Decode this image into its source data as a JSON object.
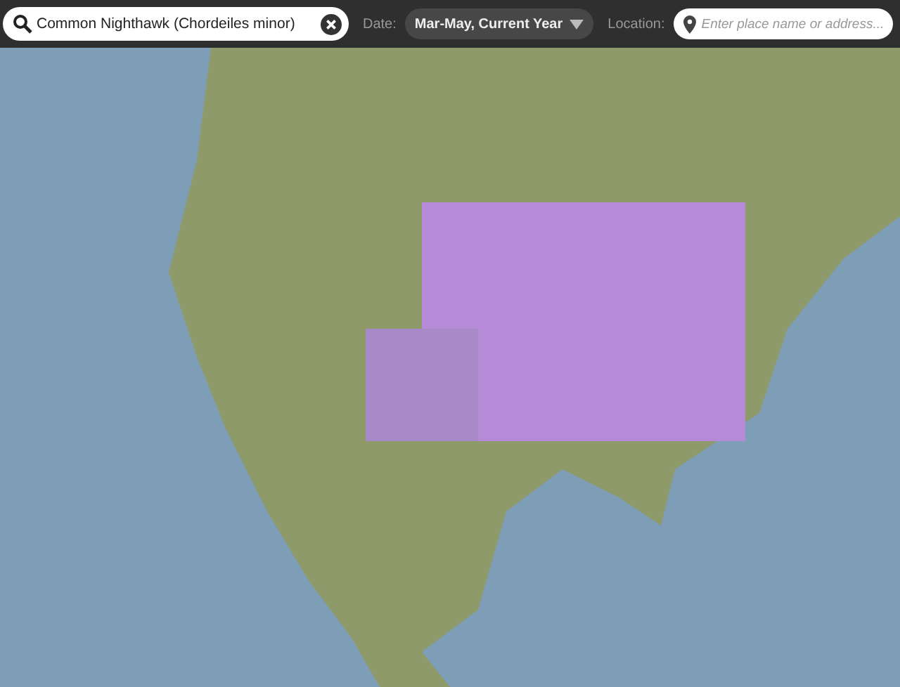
{
  "search": {
    "value": "Common Nighthawk (Chordeiles minor)"
  },
  "date": {
    "label": "Date:",
    "value": "Mar-May, Current Year"
  },
  "location": {
    "label": "Location:",
    "placeholder": "Enter place name or address..."
  }
}
